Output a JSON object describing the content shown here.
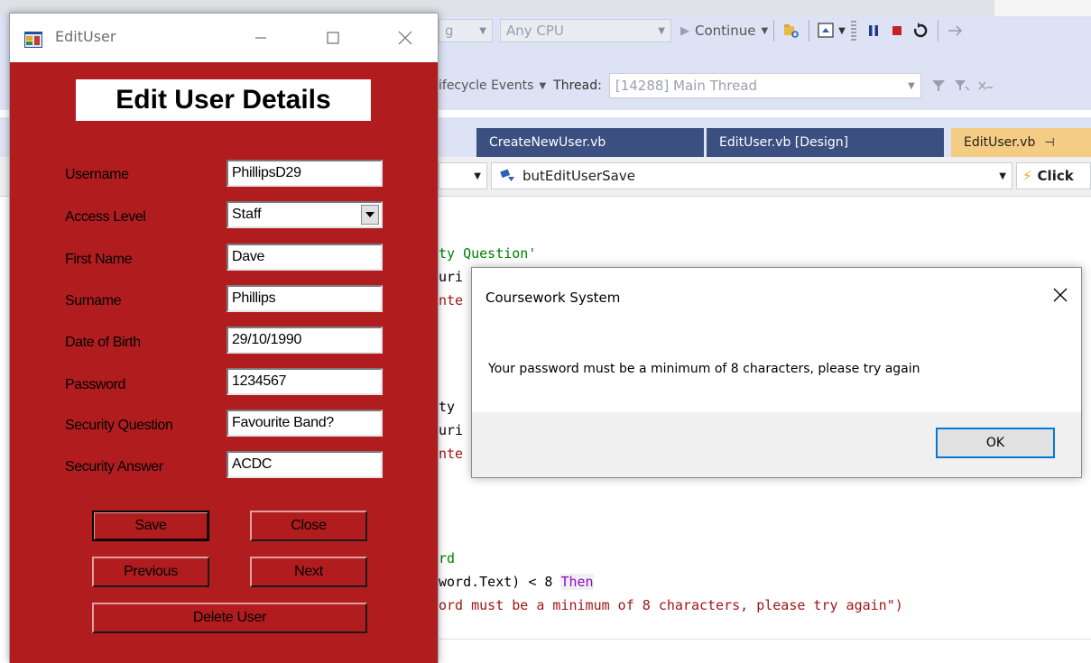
{
  "ide": {
    "toolbar": {
      "config_fragment": "g",
      "platform": "Any CPU",
      "continue_label": "Continue",
      "lifecycle_label": "ifecycle Events",
      "thread_label": "Thread:",
      "thread_value": "[14288] Main Thread"
    },
    "tabs": [
      {
        "label": "CreateNewUser.vb"
      },
      {
        "label": "EditUser.vb [Design]"
      },
      {
        "label": "EditUser.vb"
      }
    ],
    "nav": {
      "member": "butEditUserSave",
      "event": "Click"
    },
    "code": {
      "line1": "ty Question'",
      "line2": "uri",
      "line3": "nte",
      "line4": "ty",
      "line5": "uri",
      "line6": "nte",
      "line7": "rd",
      "line8a": "word.Text) < 8 ",
      "line8b": "Then",
      "line9": "ord must be a minimum of 8 characters, please try again\")"
    }
  },
  "edit_window": {
    "title": "EditUser",
    "heading": "Edit User Details",
    "fields": [
      {
        "label": "Username",
        "value": "PhillipsD29"
      },
      {
        "label": "Access Level",
        "value": "Staff"
      },
      {
        "label": "First Name",
        "value": "Dave"
      },
      {
        "label": "Surname",
        "value": "Phillips"
      },
      {
        "label": "Date of Birth",
        "value": "29/10/1990"
      },
      {
        "label": "Password",
        "value": "1234567"
      },
      {
        "label": "Security Question",
        "value": "Favourite Band?"
      },
      {
        "label": "Security Answer",
        "value": "ACDC"
      }
    ],
    "buttons": {
      "save": "Save",
      "close": "Close",
      "previous": "Previous",
      "next": "Next",
      "delete": "Delete User"
    }
  },
  "message_box": {
    "title": "Coursework System",
    "message": "Your password must be a minimum of 8 characters, please try again",
    "ok": "OK"
  },
  "colors": {
    "form_background": "#b11d1e",
    "ide_toolbar": "#dde3f5",
    "active_tab": "#f5cc84",
    "inactive_tab": "#3b4f81",
    "ok_focus": "#0078d7"
  }
}
